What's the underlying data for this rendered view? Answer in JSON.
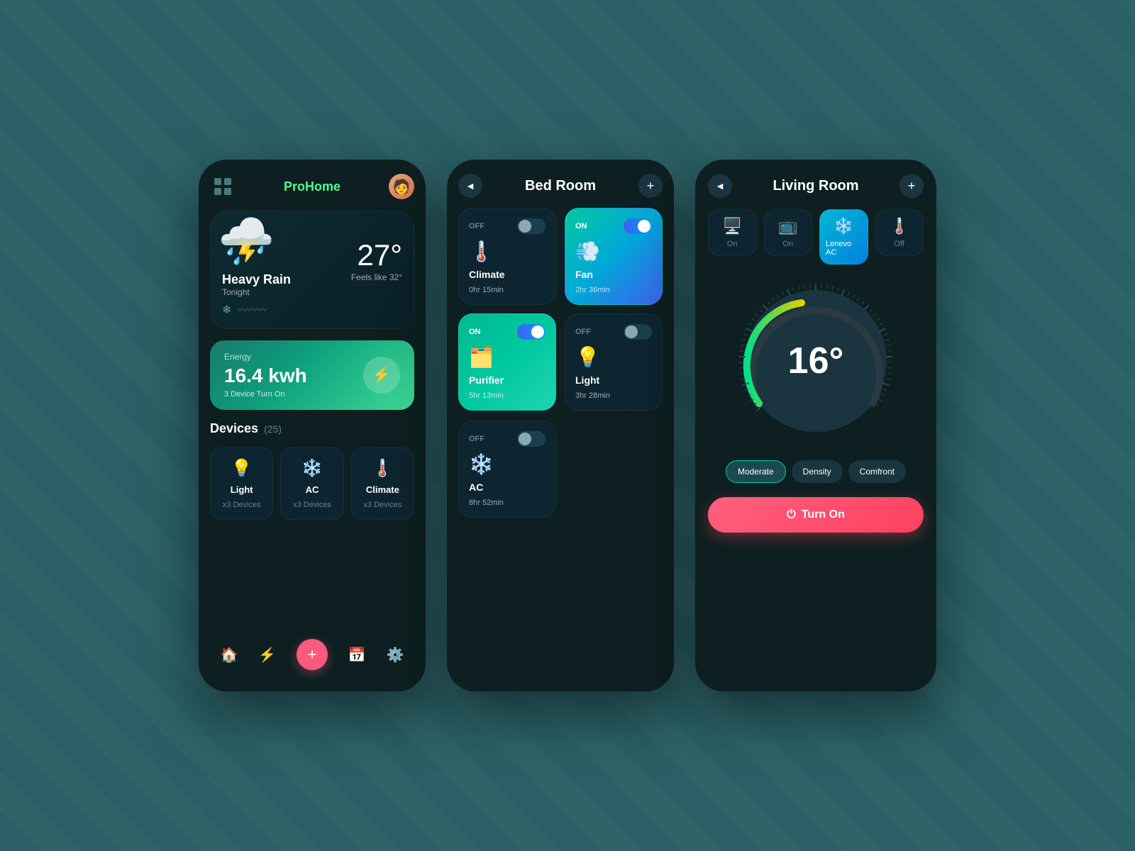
{
  "background": "#2a6065",
  "screens": {
    "screen1": {
      "title": "ProHome",
      "weather": {
        "icon": "⛈️",
        "temperature": "27°",
        "feels_like": "Feels like 32°",
        "condition": "Heavy Rain",
        "time": "Tonight"
      },
      "energy": {
        "label": "Energy",
        "value": "16.4 kwh",
        "sub": "3 Device Turn On"
      },
      "devices_title": "Devices",
      "devices_count": "(25)",
      "device_list": [
        {
          "icon": "💡",
          "name": "Light",
          "count": "x3 Devices"
        },
        {
          "icon": "❄️",
          "name": "AC",
          "count": "x3 Devices"
        },
        {
          "icon": "🌡️",
          "name": "Climate",
          "count": "x3 Devices"
        }
      ],
      "nav": {
        "home": "🏠",
        "plus": "+",
        "energy_icon": "⚡",
        "calendar": "📅",
        "settings": "⚙️"
      }
    },
    "screen2": {
      "title": "Bed Room",
      "back": "◄",
      "add": "+",
      "devices": [
        {
          "name": "Climate",
          "status": "OFF",
          "time": "0hr 15min",
          "on": false
        },
        {
          "name": "Fan",
          "status": "ON",
          "time": "2hr 36min",
          "on": true
        },
        {
          "name": "Purifier",
          "status": "ON",
          "time": "5hr 13min",
          "on": true
        },
        {
          "name": "Light",
          "status": "OFF",
          "time": "3hr 28min",
          "on": false
        },
        {
          "name": "AC",
          "status": "OFF",
          "time": "8hr 52min",
          "on": false
        }
      ]
    },
    "screen3": {
      "title": "Living Room",
      "back": "◄",
      "add": "+",
      "living_devices": [
        {
          "icon": "🖥️",
          "label": "On",
          "active": false
        },
        {
          "icon": "📺",
          "label": "On",
          "active": false
        },
        {
          "icon": "❄️",
          "label": "Lenevo AC",
          "active": true
        },
        {
          "icon": "🌡️",
          "label": "Off",
          "active": false
        }
      ],
      "temperature": "16°",
      "modes": [
        "Moderate",
        "Density",
        "Comfront"
      ],
      "active_mode": "Moderate",
      "turn_on_label": "Turn On"
    }
  }
}
